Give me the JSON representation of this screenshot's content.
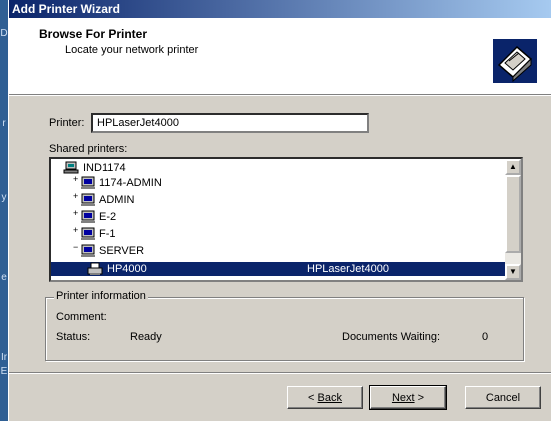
{
  "window": {
    "title": "Add Printer Wizard"
  },
  "header": {
    "title": "Browse For Printer",
    "subtitle": "Locate your network printer"
  },
  "printer_field": {
    "label": "Printer:",
    "value": "HPLaserJet4000"
  },
  "shared": {
    "label": "Shared printers:"
  },
  "tree": {
    "items": [
      {
        "label": "IND1174",
        "icon": "network-icon"
      },
      {
        "label": "1174-ADMIN",
        "icon": "computer-icon"
      },
      {
        "label": "ADMIN",
        "icon": "computer-icon"
      },
      {
        "label": "E-2",
        "icon": "computer-icon"
      },
      {
        "label": "F-1",
        "icon": "computer-icon"
      },
      {
        "label": "SERVER",
        "icon": "computer-icon"
      },
      {
        "label": "HP4000",
        "comment": "HPLaserJet4000",
        "icon": "printer-icon",
        "selected": true
      }
    ]
  },
  "printer_info": {
    "title": "Printer information",
    "comment_label": "Comment:",
    "status_label": "Status:",
    "status_value": "Ready",
    "docs_label": "Documents Waiting:",
    "docs_value": "0"
  },
  "buttons": {
    "back": "Back",
    "next": "Next",
    "cancel": "Cancel"
  },
  "desktop_glyphs": [
    "D",
    "r",
    "y",
    "e",
    "Ir",
    "E"
  ]
}
